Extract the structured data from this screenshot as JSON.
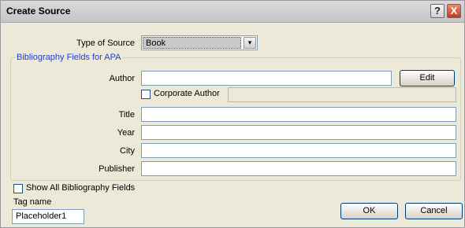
{
  "window": {
    "title": "Create Source",
    "help_glyph": "?",
    "close_glyph": "X"
  },
  "source_type": {
    "label": "Type of Source",
    "value": "Book",
    "arrow_glyph": "▾"
  },
  "fields_group": {
    "label": "Bibliography Fields for APA"
  },
  "author": {
    "label": "Author",
    "value": "",
    "edit_label": "Edit"
  },
  "corporate_author": {
    "label": "Corporate Author",
    "checked": false
  },
  "title_field": {
    "label": "Title",
    "value": ""
  },
  "year_field": {
    "label": "Year",
    "value": ""
  },
  "city_field": {
    "label": "City",
    "value": ""
  },
  "publisher_field": {
    "label": "Publisher",
    "value": ""
  },
  "show_all": {
    "label": "Show All Bibliography Fields",
    "checked": false
  },
  "tag": {
    "label": "Tag name",
    "value": "Placeholder1"
  },
  "buttons": {
    "ok": "OK",
    "cancel": "Cancel"
  }
}
